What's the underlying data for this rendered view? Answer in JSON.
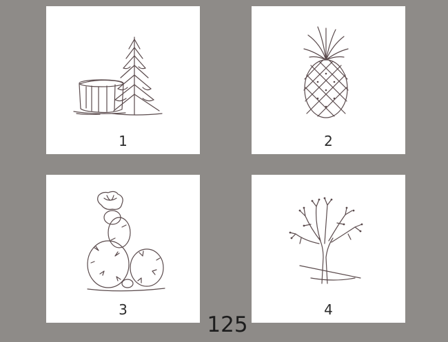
{
  "cards": [
    {
      "number": "1",
      "illustration": "tree-stump-and-fir-icon"
    },
    {
      "number": "2",
      "illustration": "pineapple-icon"
    },
    {
      "number": "3",
      "illustration": "prickly-pear-cactus-icon"
    },
    {
      "number": "4",
      "illustration": "bare-tree-icon"
    }
  ],
  "page_number": "125",
  "colors": {
    "background": "#8e8b88",
    "card": "#ffffff",
    "ink": "#5a4a4c"
  }
}
